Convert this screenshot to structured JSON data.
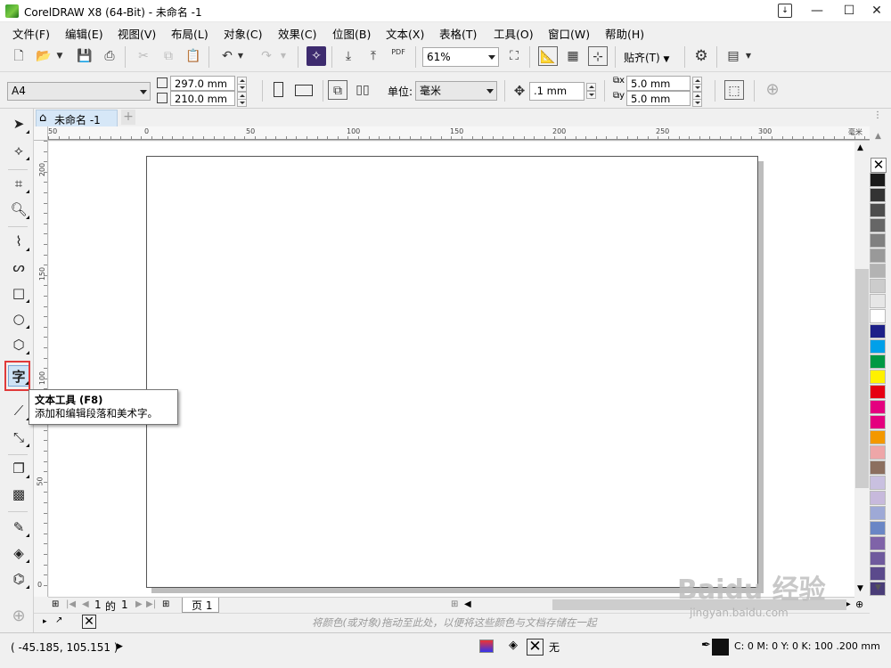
{
  "titlebar": {
    "title": "CorelDRAW X8 (64-Bit) - 未命名 -1",
    "minimize": "—",
    "maximize": "☐",
    "close": "✕"
  },
  "menu": [
    "文件(F)",
    "编辑(E)",
    "视图(V)",
    "布局(L)",
    "对象(C)",
    "效果(C)",
    "位图(B)",
    "文本(X)",
    "表格(T)",
    "工具(O)",
    "窗口(W)",
    "帮助(H)"
  ],
  "toolbar1": {
    "pdf_label": "PDF",
    "zoom_value": "61%",
    "snap_label": "贴齐(T)"
  },
  "toolbar2": {
    "page_size": "A4",
    "width_value": "297.0 mm",
    "height_value": "210.0 mm",
    "unit_label": "单位:",
    "unit_value": "毫米",
    "nudge_value": ".1 mm",
    "dup_x_value": "5.0 mm",
    "dup_y_value": "5.0 mm"
  },
  "tabs": {
    "doc_tab": "未命名 -1",
    "add_tab": "+"
  },
  "ruler": {
    "top_labels": [
      "50",
      "0",
      "50",
      "100",
      "150",
      "200",
      "250",
      "300"
    ],
    "unit": "毫米",
    "left_labels": [
      "200",
      "150",
      "100",
      "50",
      "0"
    ]
  },
  "tooltip": {
    "title": "文本工具 (F8)",
    "body": "添加和编辑段落和美术字。"
  },
  "pagenav": {
    "current": "1",
    "of_label": "的",
    "total": "1",
    "page_tab": "页 1"
  },
  "colorbar": {
    "hint": "将颜色(或对象)拖动至此处，以便将这些颜色与文档存储在一起"
  },
  "status": {
    "coords": "( -45.185, 105.151 )",
    "fill_label": "无",
    "outline_info": "C: 0 M: 0 Y: 0 K: 100  .200 mm"
  },
  "palette_colors": [
    "#ffffff",
    "#1a1a1a",
    "#333333",
    "#4d4d4d",
    "#666666",
    "#808080",
    "#999999",
    "#b3b3b3",
    "#cccccc",
    "#e6e6e6",
    "#ffffff",
    "#1d2088",
    "#00a0e9",
    "#009944",
    "#fff100",
    "#e60012",
    "#e4007f",
    "#e4007f",
    "#f39800",
    "#eea6a8",
    "#8c6f5f",
    "#c9c0e0",
    "#c7b9dc",
    "#9ea9d6",
    "#6a86c5",
    "#7f63a8",
    "#6f5a9d",
    "#5b4a8c",
    "#4a3d78"
  ],
  "watermark": "Baidu 经验",
  "watermark_url": "jingyan.baidu.com"
}
